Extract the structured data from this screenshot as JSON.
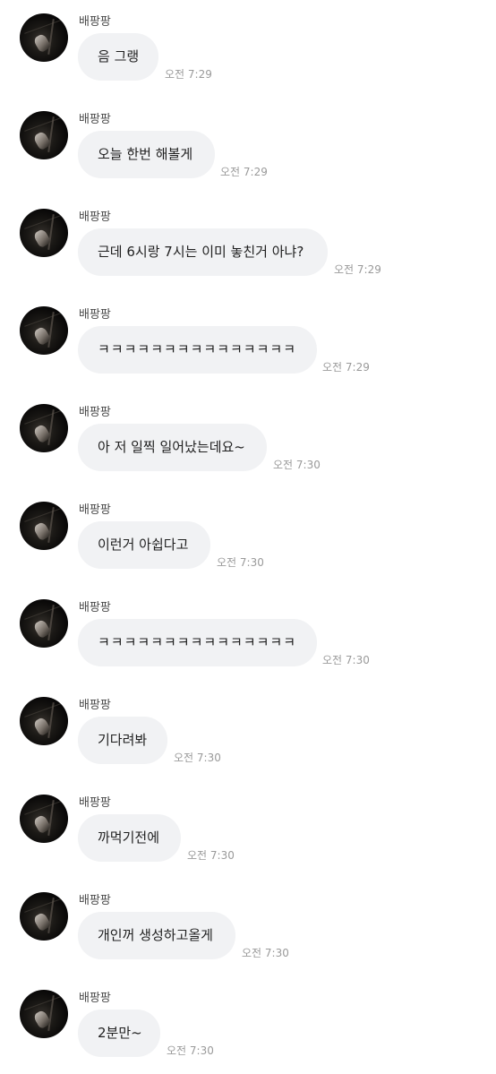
{
  "messages": [
    {
      "sender": "배팡팡",
      "text": "음 그랭",
      "time": "오전 7:29"
    },
    {
      "sender": "배팡팡",
      "text": "오늘 한번 해볼게",
      "time": "오전 7:29"
    },
    {
      "sender": "배팡팡",
      "text": "근데 6시랑 7시는 이미 놓친거 아냐?",
      "time": "오전 7:29"
    },
    {
      "sender": "배팡팡",
      "text": "ㅋㅋㅋㅋㅋㅋㅋㅋㅋㅋㅋㅋㅋㅋㅋ",
      "time": "오전 7:29"
    },
    {
      "sender": "배팡팡",
      "text": "아 저 일찍 일어났는데요~",
      "time": "오전 7:30"
    },
    {
      "sender": "배팡팡",
      "text": "이런거 아쉽다고",
      "time": "오전 7:30"
    },
    {
      "sender": "배팡팡",
      "text": "ㅋㅋㅋㅋㅋㅋㅋㅋㅋㅋㅋㅋㅋㅋㅋ",
      "time": "오전 7:30"
    },
    {
      "sender": "배팡팡",
      "text": "기다려봐",
      "time": "오전 7:30"
    },
    {
      "sender": "배팡팡",
      "text": "까먹기전에",
      "time": "오전 7:30"
    },
    {
      "sender": "배팡팡",
      "text": "개인꺼 생성하고올게",
      "time": "오전 7:30"
    },
    {
      "sender": "배팡팡",
      "text": "2분만~",
      "time": "오전 7:30"
    }
  ]
}
